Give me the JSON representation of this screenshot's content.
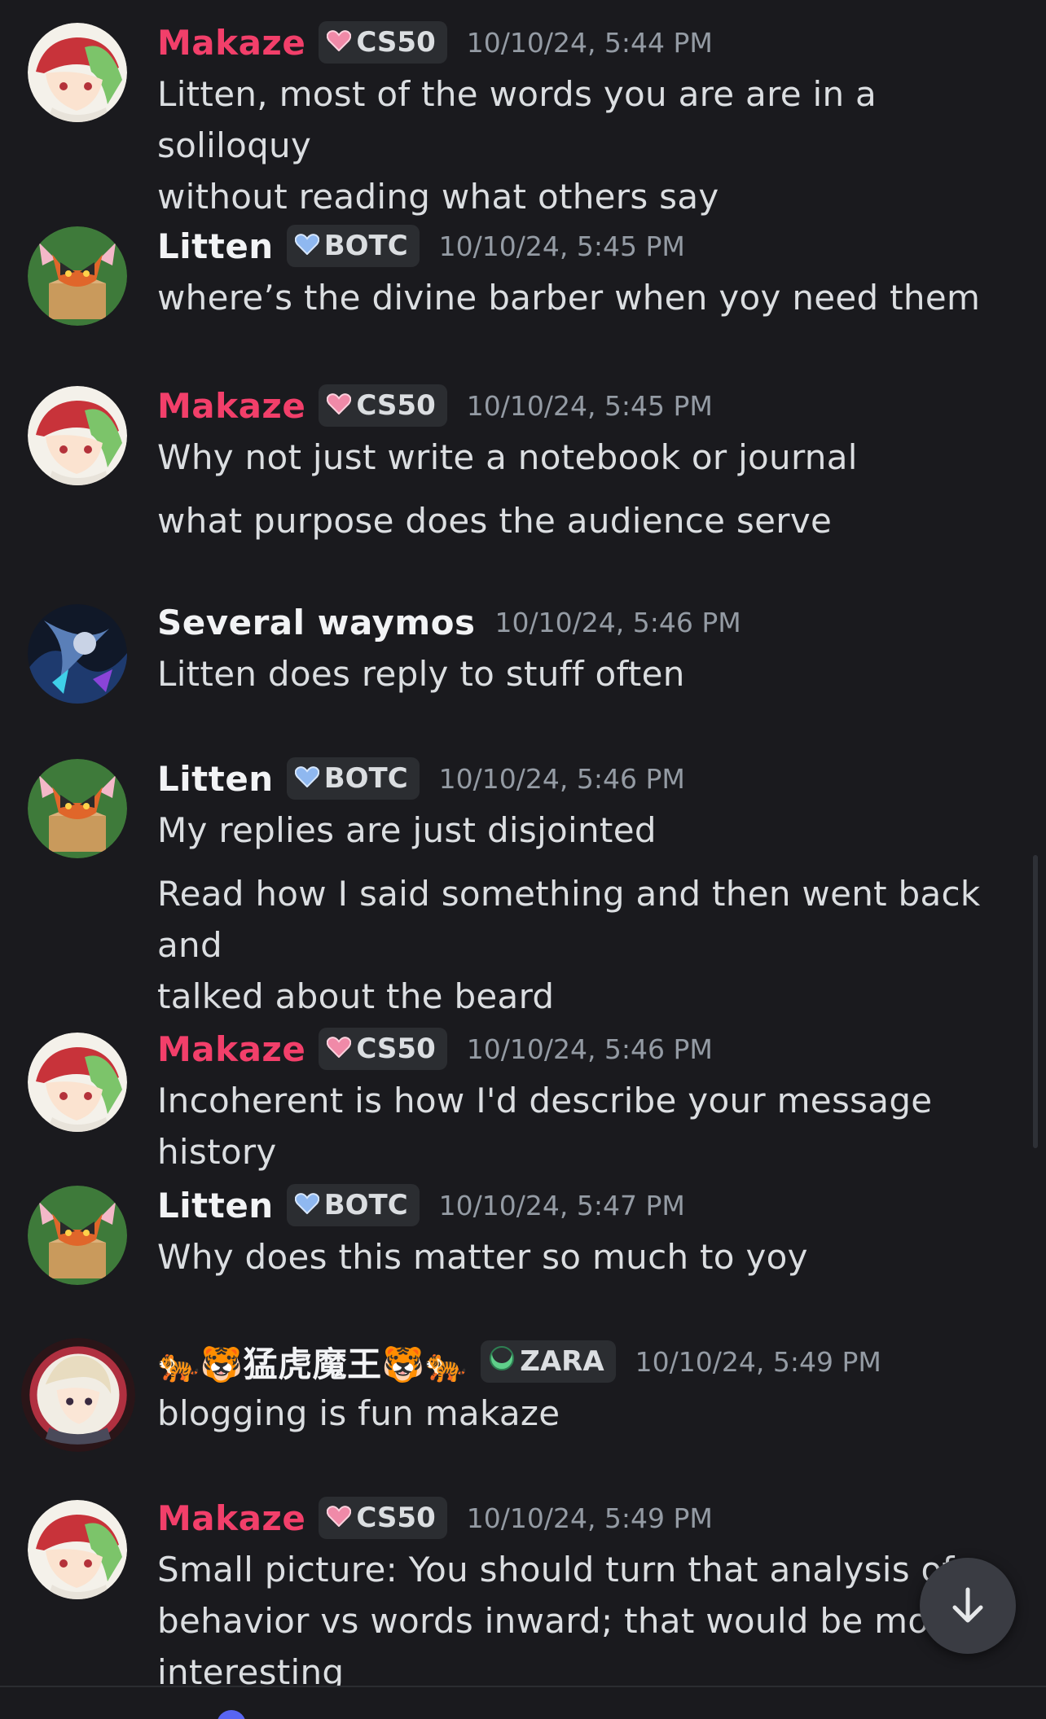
{
  "messages": [
    {
      "author": "Makaze",
      "author_color": "#f23f6a",
      "avatar_icon": "anime-girl-avatar",
      "tag_icon": "pink-heart-icon",
      "tag": "CS50",
      "timestamp": "10/10/24, 5:44 PM",
      "lines": [
        "Litten, most of the words you are are in a soliloquy",
        "without reading what others say"
      ]
    },
    {
      "author": "Litten",
      "author_color": "#f2f3f5",
      "avatar_icon": "litten-cat-avatar",
      "tag_icon": "blue-heart-icon",
      "tag": "BOTC",
      "timestamp": "10/10/24, 5:45 PM",
      "lines": [
        "where’s the divine barber when yoy need them"
      ]
    },
    {
      "author": "Makaze",
      "author_color": "#f23f6a",
      "avatar_icon": "anime-girl-avatar",
      "tag_icon": "pink-heart-icon",
      "tag": "CS50",
      "timestamp": "10/10/24, 5:45 PM",
      "lines": [
        "Why not just write a notebook or journal",
        "what purpose does the audience serve"
      ]
    },
    {
      "author": "Several waymos",
      "author_color": "#f2f3f5",
      "avatar_icon": "dark-art-avatar",
      "tag": "",
      "timestamp": "10/10/24, 5:46 PM",
      "lines": [
        "Litten does reply to stuff often"
      ]
    },
    {
      "author": "Litten",
      "author_color": "#f2f3f5",
      "avatar_icon": "litten-cat-avatar",
      "tag_icon": "blue-heart-icon",
      "tag": "BOTC",
      "timestamp": "10/10/24, 5:46 PM",
      "lines": [
        "My replies are just disjointed",
        "Read how I said something and then went back and",
        "talked about the beard"
      ]
    },
    {
      "author": "Makaze",
      "author_color": "#f23f6a",
      "avatar_icon": "anime-girl-avatar",
      "tag_icon": "pink-heart-icon",
      "tag": "CS50",
      "timestamp": "10/10/24, 5:46 PM",
      "lines": [
        "Incoherent is how I'd describe your message history"
      ]
    },
    {
      "author": "Litten",
      "author_color": "#f2f3f5",
      "avatar_icon": "litten-cat-avatar",
      "tag_icon": "blue-heart-icon",
      "tag": "BOTC",
      "timestamp": "10/10/24, 5:47 PM",
      "lines": [
        "Why does this matter so much to yoy"
      ]
    },
    {
      "author": "🐅🐯猛虎魔王🐯🐅",
      "author_color": "#f2f3f5",
      "avatar_icon": "white-haired-character-avatar",
      "tag_icon": "green-crescent-icon",
      "tag": "ZARA",
      "timestamp": "10/10/24, 5:49 PM",
      "lines": [
        "blogging is fun makaze"
      ]
    },
    {
      "author": "Makaze",
      "author_color": "#f23f6a",
      "avatar_icon": "anime-girl-avatar",
      "tag_icon": "pink-heart-icon",
      "tag": "CS50",
      "timestamp": "10/10/24, 5:49 PM",
      "lines": [
        "Small picture: You should turn that analysis of",
        "behavior vs words inward; that would be more",
        "interesting"
      ]
    }
  ],
  "jump_button_icon": "arrow-down-icon"
}
